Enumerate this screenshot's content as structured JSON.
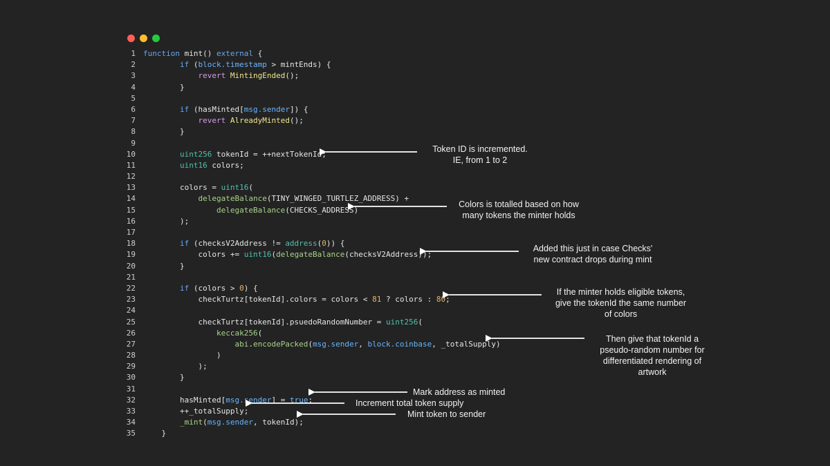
{
  "window": {
    "buttons": [
      "close",
      "minimize",
      "maximize"
    ],
    "colors": {
      "close": "#ff5f56",
      "minimize": "#ffbd2e",
      "maximize": "#27c93f"
    }
  },
  "code_lines": [
    {
      "n": "1",
      "text": "function mint() external {"
    },
    {
      "n": "2",
      "text": "        if (block.timestamp > mintEnds) {"
    },
    {
      "n": "3",
      "text": "            revert MintingEnded();"
    },
    {
      "n": "4",
      "text": "        }"
    },
    {
      "n": "5",
      "text": ""
    },
    {
      "n": "6",
      "text": "        if (hasMinted[msg.sender]) {"
    },
    {
      "n": "7",
      "text": "            revert AlreadyMinted();"
    },
    {
      "n": "8",
      "text": "        }"
    },
    {
      "n": "9",
      "text": ""
    },
    {
      "n": "10",
      "text": "        uint256 tokenId = ++nextTokenId;"
    },
    {
      "n": "11",
      "text": "        uint16 colors;"
    },
    {
      "n": "12",
      "text": ""
    },
    {
      "n": "13",
      "text": "        colors = uint16("
    },
    {
      "n": "14",
      "text": "            delegateBalance(TINY_WINGED_TURTLEZ_ADDRESS) +"
    },
    {
      "n": "15",
      "text": "                delegateBalance(CHECKS_ADDRESS)"
    },
    {
      "n": "16",
      "text": "        );"
    },
    {
      "n": "17",
      "text": ""
    },
    {
      "n": "18",
      "text": "        if (checksV2Address != address(0)) {"
    },
    {
      "n": "19",
      "text": "            colors += uint16(delegateBalance(checksV2Address));"
    },
    {
      "n": "20",
      "text": "        }"
    },
    {
      "n": "21",
      "text": ""
    },
    {
      "n": "22",
      "text": "        if (colors > 0) {"
    },
    {
      "n": "23",
      "text": "            checkTurtz[tokenId].colors = colors < 81 ? colors : 80;"
    },
    {
      "n": "24",
      "text": ""
    },
    {
      "n": "25",
      "text": "            checkTurtz[tokenId].psuedoRandomNumber = uint256("
    },
    {
      "n": "26",
      "text": "                keccak256("
    },
    {
      "n": "27",
      "text": "                    abi.encodePacked(msg.sender, block.coinbase, _totalSupply)"
    },
    {
      "n": "28",
      "text": "                )"
    },
    {
      "n": "29",
      "text": "            );"
    },
    {
      "n": "30",
      "text": "        }"
    },
    {
      "n": "31",
      "text": ""
    },
    {
      "n": "32",
      "text": "        hasMinted[msg.sender] = true;"
    },
    {
      "n": "33",
      "text": "        ++_totalSupply;"
    },
    {
      "n": "34",
      "text": "        _mint(msg.sender, tokenId);"
    },
    {
      "n": "35",
      "text": "    }"
    }
  ],
  "annotations": {
    "token_id": [
      "Token ID is incremented.",
      "IE, from 1 to 2"
    ],
    "colors_total": [
      "Colors is totalled based on how",
      "many tokens the minter holds"
    ],
    "checks_v2": [
      "Added this just in case Checks'",
      "new contract drops during mint"
    ],
    "eligible": [
      "If the minter holds eligible tokens,",
      "give the tokenId the same number",
      "of colors"
    ],
    "pseudo_random": [
      "Then give that tokenId a",
      "pseudo-random number for",
      "differentiated rendering of",
      "artwork"
    ],
    "mark_minted": "Mark address as minted",
    "increment_supply": "Increment total token supply",
    "mint_token": "Mint token to sender"
  }
}
